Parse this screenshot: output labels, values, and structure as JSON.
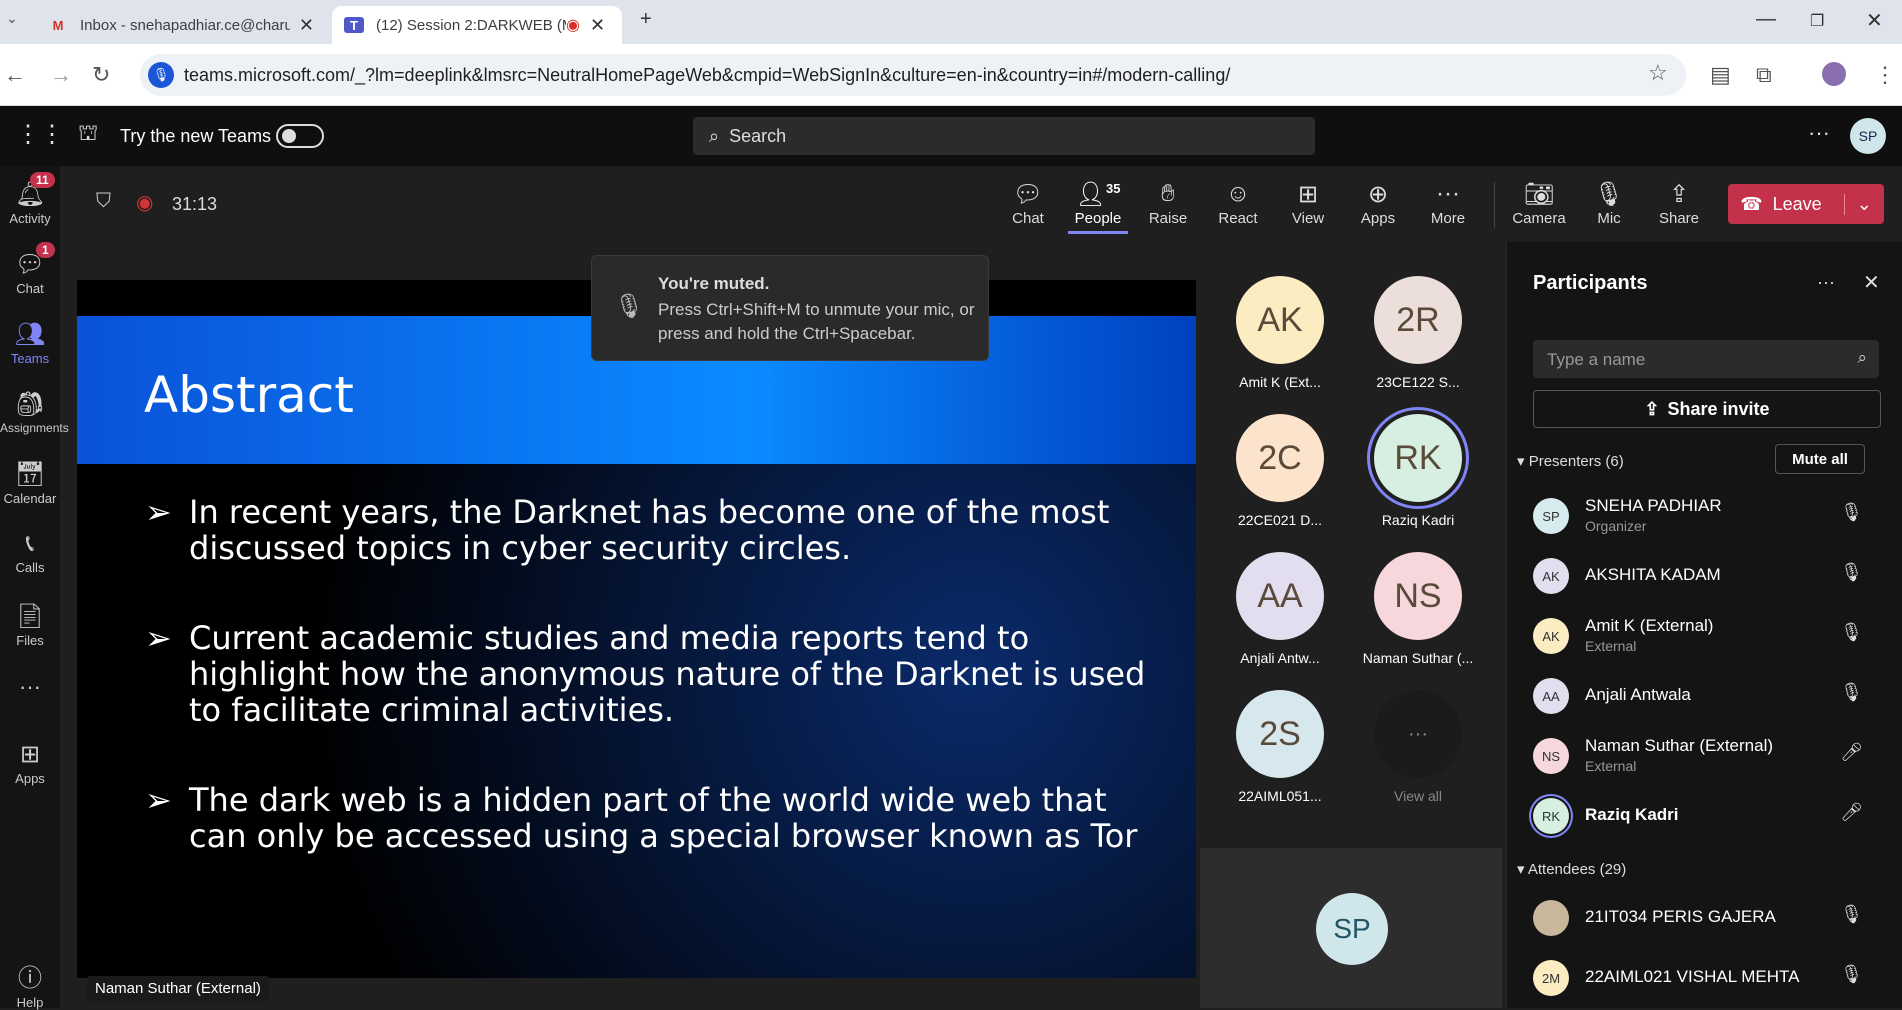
{
  "browser": {
    "tabs": [
      {
        "title": "Inbox - snehapadhiar.ce@charu"
      },
      {
        "title": "(12) Session 2:DARKWEB (M"
      }
    ],
    "url": "teams.microsoft.com/_?lm=deeplink&lmsrc=NeutralHomePageWeb&cmpid=WebSignIn&culture=en-in&country=in#/modern-calling/"
  },
  "teams": {
    "try_new": "Try the new Teams",
    "search": "Search",
    "user": "SP"
  },
  "rail": [
    {
      "label": "Activity",
      "badge": "11"
    },
    {
      "label": "Chat",
      "badge": "1"
    },
    {
      "label": "Teams"
    },
    {
      "label": "Assignments"
    },
    {
      "label": "Calendar"
    },
    {
      "label": "Calls"
    },
    {
      "label": "Files"
    },
    {
      "label": "Apps"
    },
    {
      "label": "Help"
    }
  ],
  "call": {
    "timer": "31:13",
    "people_count": "35",
    "buttons": [
      "Chat",
      "People",
      "Raise",
      "React",
      "View",
      "Apps",
      "More",
      "Camera",
      "Mic",
      "Share"
    ],
    "leave": "Leave"
  },
  "slide": {
    "title": "Abstract",
    "bullets": [
      "In recent years, the Darknet has become one of the most discussed topics in cyber security circles.",
      "Current academic studies and media reports tend to highlight how the anonymous nature of the Darknet is used to facilitate criminal activities.",
      "The dark web is a hidden part of the world wide web that can only be accessed using a special browser known as Tor"
    ]
  },
  "muted": {
    "title": "You're muted.",
    "text": "Press Ctrl+Shift+M to unmute your mic, or press and hold the Ctrl+Spacebar."
  },
  "speaker_label": "Naman Suthar (External)",
  "gallery": [
    {
      "initials": "AK",
      "name": "Amit K (Ext...",
      "color": "#fbecc2"
    },
    {
      "initials": "2R",
      "name": "23CE122 S...",
      "color": "#ecdfdb"
    },
    {
      "initials": "2C",
      "name": "22CE021 D...",
      "color": "#fbe3cc"
    },
    {
      "initials": "RK",
      "name": "Raziq Kadri",
      "color": "#d6efe1"
    },
    {
      "initials": "AA",
      "name": "Anjali Antw...",
      "color": "#e2def0"
    },
    {
      "initials": "NS",
      "name": "Naman Suthar (...",
      "color": "#f6d8dc"
    },
    {
      "initials": "2S",
      "name": "22AIML051...",
      "color": "#d6e8ee"
    },
    {
      "initials": "···",
      "name": "View all",
      "color": "#1b1b1b"
    }
  ],
  "self_initials": "SP",
  "panel": {
    "title": "Participants",
    "search_placeholder": "Type a name",
    "share_invite": "Share invite",
    "presenters_label": "Presenters (6)",
    "mute_all": "Mute all",
    "attendees_label": "Attendees (29)",
    "presenters": [
      {
        "initials": "SP",
        "name": "SNEHA PADHIAR",
        "role": "Organizer",
        "color": "#d6ecee"
      },
      {
        "initials": "AK",
        "name": "AKSHITA KADAM",
        "role": "",
        "color": "#e2def0"
      },
      {
        "initials": "AK",
        "name": "Amit K (External)",
        "role": "External",
        "color": "#fbecc2"
      },
      {
        "initials": "AA",
        "name": "Anjali Antwala",
        "role": "",
        "color": "#e2def0"
      },
      {
        "initials": "NS",
        "name": "Naman Suthar (External)",
        "role": "External",
        "color": "#f6d8dc"
      },
      {
        "initials": "RK",
        "name": "Raziq Kadri",
        "role": "",
        "color": "#d6efe1"
      }
    ],
    "attendees": [
      {
        "initials": "",
        "name": "21IT034 PERIS GAJERA",
        "color": "#c9b79c"
      },
      {
        "initials": "2M",
        "name": "22AIML021 VISHAL MEHTA",
        "color": "#fbecc2"
      }
    ]
  }
}
